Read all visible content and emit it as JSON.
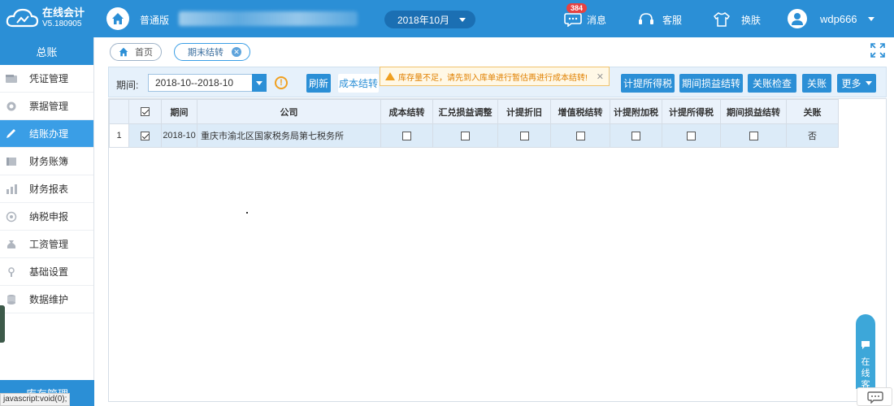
{
  "header": {
    "app_name": "在线会计",
    "version": "V5.180905",
    "edition": "普通版",
    "period": "2018年10月",
    "message_badge": "384",
    "messages_label": "消息",
    "service_label": "客服",
    "skin_label": "换肤",
    "username": "wdp666"
  },
  "sidebar": {
    "title": "总账",
    "items": [
      {
        "label": "凭证管理"
      },
      {
        "label": "票据管理"
      },
      {
        "label": "结账办理"
      },
      {
        "label": "财务账簿"
      },
      {
        "label": "财务报表"
      },
      {
        "label": "纳税申报"
      },
      {
        "label": "工资管理"
      },
      {
        "label": "基础设置"
      },
      {
        "label": "数据维护"
      }
    ],
    "bottom_label": "库存管理"
  },
  "status_bar": "javascript:void(0);",
  "tabs": [
    {
      "label": "首页"
    },
    {
      "label": "期末结转"
    }
  ],
  "toolbar": {
    "period_label": "期间:",
    "period_value": "2018-10--2018-10",
    "refresh": "刷新",
    "cost_transfer": "成本结转",
    "income_tax": "计提所得税",
    "period_pl": "期间损益结转",
    "close_check": "关账检查",
    "close": "关账",
    "more": "更多"
  },
  "warning_tooltip": "库存量不足，请先到入库单进行暂估再进行成本结转!",
  "table": {
    "columns": [
      "",
      "",
      "期间",
      "公司",
      "成本结转",
      "汇兑损益调整",
      "计提折旧",
      "增值税结转",
      "计提附加税",
      "计提所得税",
      "期间损益结转",
      "关账"
    ],
    "rows": [
      {
        "num": "1",
        "period": "2018-10",
        "company": "重庆市渝北区国家税务局第七税务所",
        "closed": "否"
      }
    ]
  },
  "chat_widget": "在线客服"
}
